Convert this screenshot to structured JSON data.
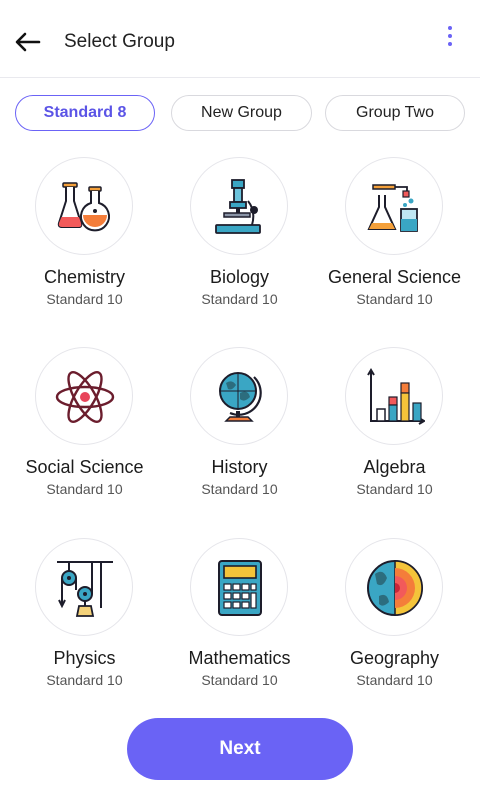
{
  "header": {
    "title": "Select Group",
    "back_icon": "arrow-left-icon",
    "menu_icon": "more-vertical-icon"
  },
  "chips": [
    {
      "label": "Standard 8",
      "active": true
    },
    {
      "label": "New Group",
      "active": false
    },
    {
      "label": "Group Two",
      "active": false
    }
  ],
  "subjects": [
    {
      "name": "Chemistry",
      "standard": "Standard 10",
      "icon": "flasks-icon"
    },
    {
      "name": "Biology",
      "standard": "Standard 10",
      "icon": "microscope-icon"
    },
    {
      "name": "General Science",
      "standard": "Standard 10",
      "icon": "lab-equipment-icon"
    },
    {
      "name": "Social Science",
      "standard": "Standard 10",
      "icon": "atom-icon"
    },
    {
      "name": "History",
      "standard": "Standard 10",
      "icon": "globe-icon"
    },
    {
      "name": "Algebra",
      "standard": "Standard 10",
      "icon": "bar-chart-icon"
    },
    {
      "name": "Physics",
      "standard": "Standard 10",
      "icon": "pulley-icon"
    },
    {
      "name": "Mathematics",
      "standard": "Standard 10",
      "icon": "calculator-icon"
    },
    {
      "name": "Geography",
      "standard": "Standard 10",
      "icon": "earth-layers-icon"
    }
  ],
  "footer": {
    "next_label": "Next"
  },
  "colors": {
    "accent": "#6a63f5",
    "border": "#e5e5ea"
  }
}
